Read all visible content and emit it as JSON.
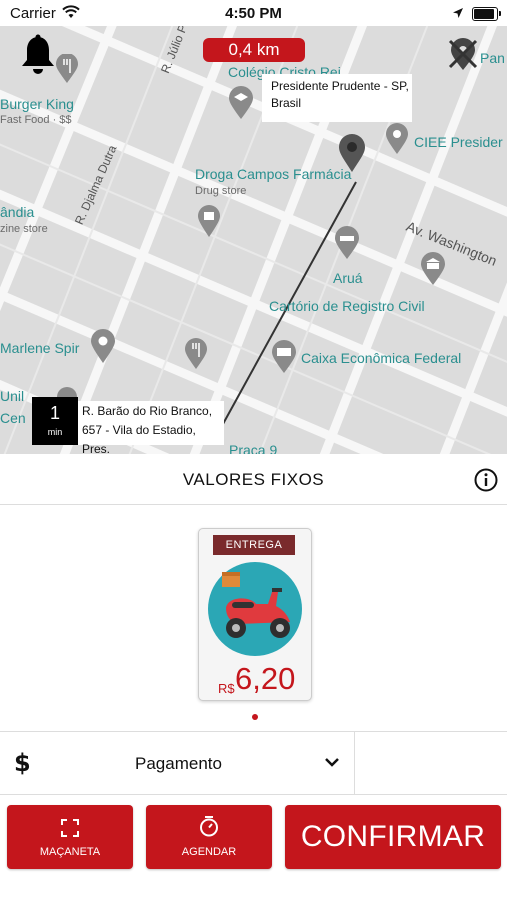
{
  "status_bar": {
    "carrier": "Carrier",
    "time": "4:50 PM"
  },
  "map": {
    "distance": "0,4 km",
    "destination_address": [
      "Presidente Prudente - SP,",
      "Brasil"
    ],
    "origin": {
      "eta_value": "1",
      "eta_unit": "min",
      "address": [
        "R. Barão do Rio Branco,",
        "657 - Vila do Estadio, Pres."
      ]
    },
    "places": {
      "burger_king": "Burger King",
      "burger_king_sub": "Fast Food · $$",
      "colegio": "Colégio Cristo Rei",
      "pan": "Pan",
      "ciee": "CIEE Presider",
      "droga": "Droga Campos Farmácia",
      "droga_sub": "Drug store",
      "landia": "ândia",
      "landia_sub": "zine store",
      "arua": "Aruá",
      "cartorio": "Cartório de Registro Civil",
      "marlene": "Marlene Spir",
      "caixa": "Caixa Econômica Federal",
      "unil": "Unil",
      "cen": "Cen",
      "praca": "Praça 9"
    },
    "roads": {
      "julio": "R. Júlio P",
      "djalma": "R. Djalma Dutra",
      "washington": "Av. Washington"
    }
  },
  "section": {
    "title": "VALORES FIXOS"
  },
  "card": {
    "tag": "ENTREGA",
    "currency": "R$",
    "price": "6,20"
  },
  "payment": {
    "label": "Pagamento"
  },
  "buttons": {
    "handle": "MAÇANETA",
    "schedule": "AGENDAR",
    "confirm": "CONFIRMAR"
  },
  "colors": {
    "accent": "#c4161c",
    "tag": "#7a2a2c",
    "map_bg": "#dcdcdc",
    "map_road": "#f7f7f7"
  }
}
